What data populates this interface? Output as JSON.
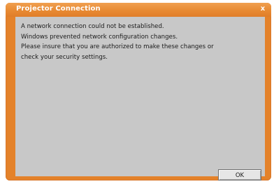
{
  "window": {
    "title": "Projector Connection",
    "close_glyph": "x"
  },
  "message": {
    "lines": [
      "A network connection could not be established.",
      "Windows prevented network configuration changes.",
      "Please insure that you are authorized to make these changes or",
      "check your security settings."
    ]
  },
  "buttons": {
    "ok_label": "OK"
  },
  "colors": {
    "frame": "#e4822a",
    "client": "#c8c8c8",
    "title_text": "#ffffff"
  },
  "icons": {
    "close": "close-icon"
  }
}
